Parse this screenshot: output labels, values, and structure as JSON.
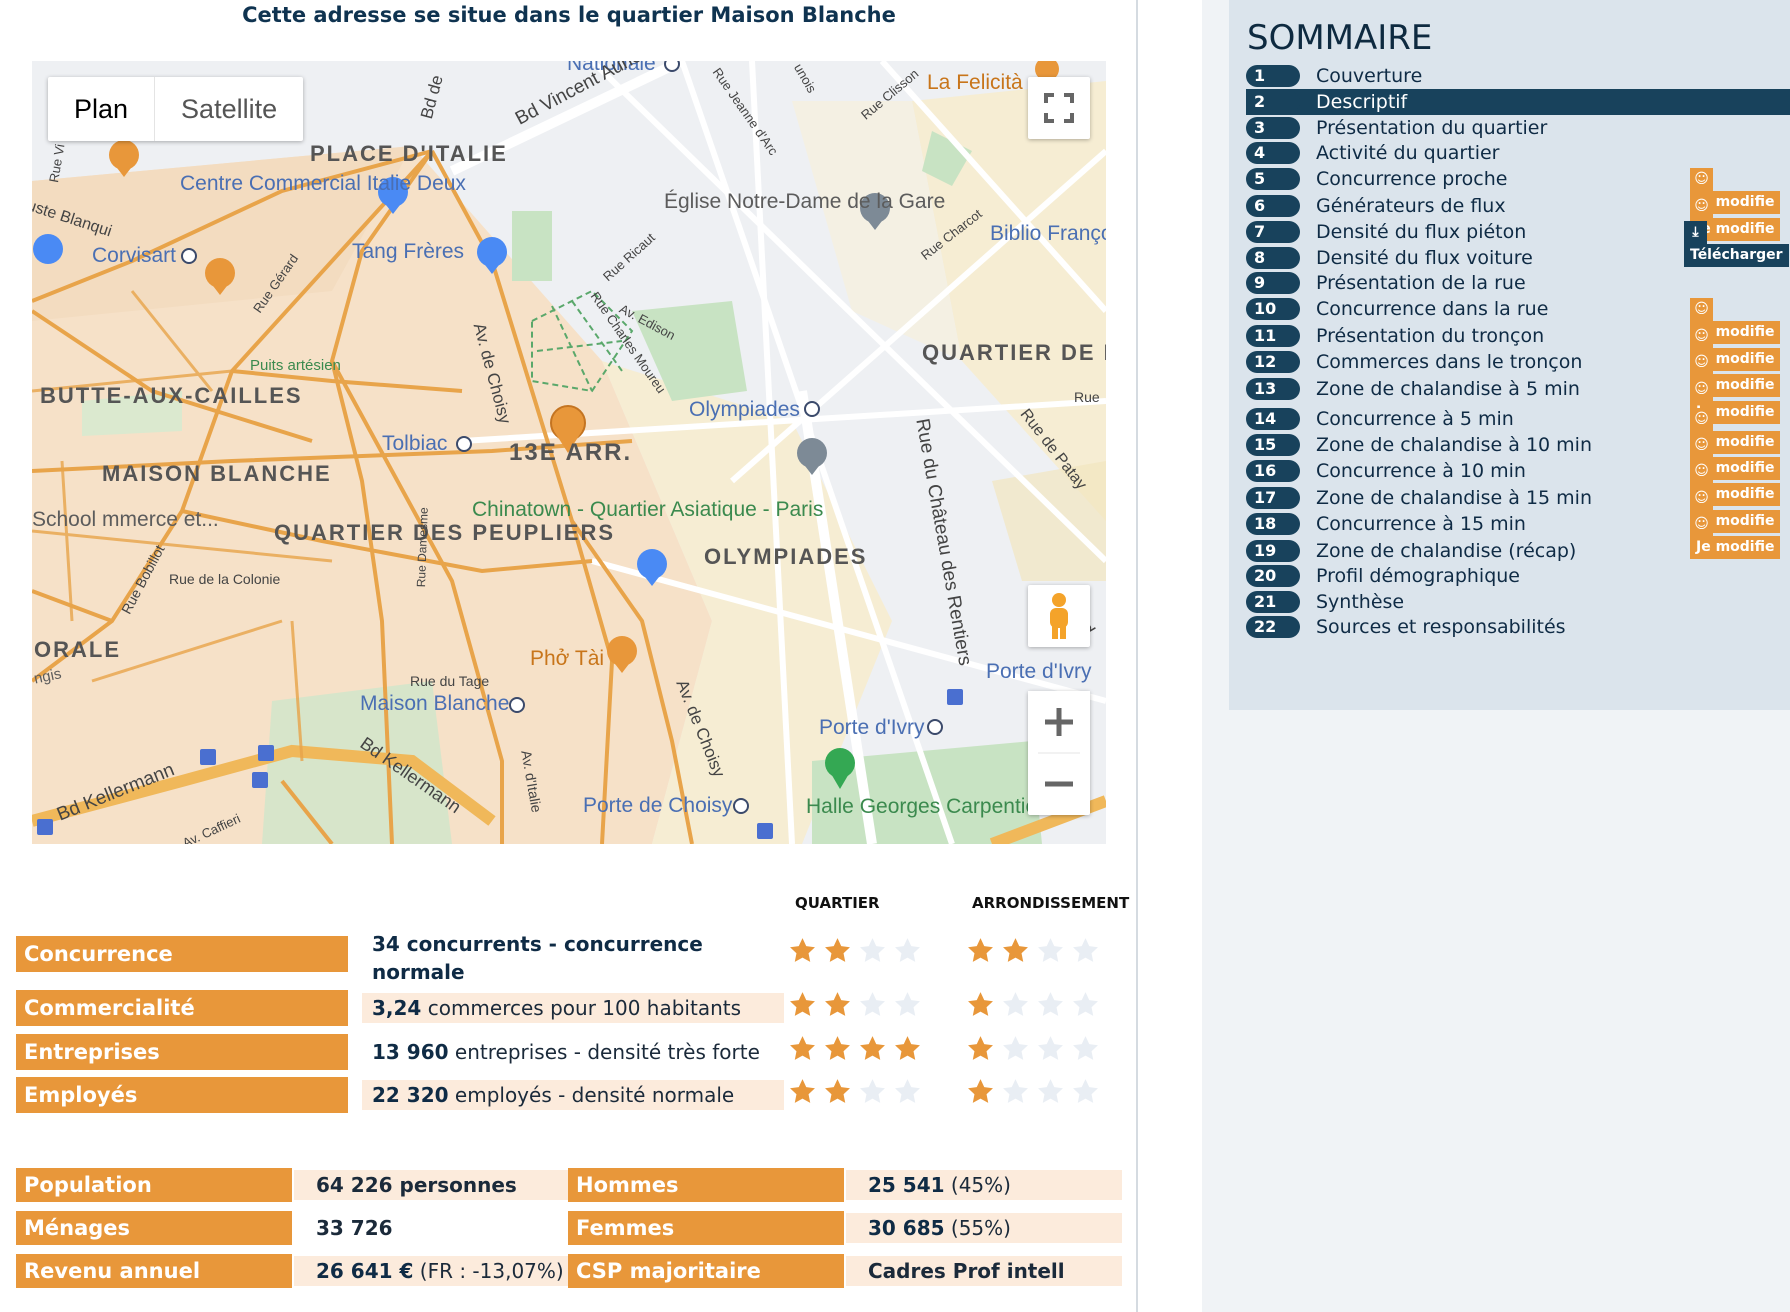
{
  "headline": "Cette adresse se situe dans le quartier Maison Blanche",
  "map": {
    "type_buttons": [
      "Plan",
      "Satellite"
    ],
    "labels": {
      "nationale": "Nationale",
      "la_felicita": "La Felicità",
      "place_italie": "PLACE D'ITALIE",
      "bd_vincent_auriol": "Bd Vincent Auriol",
      "bd_de": "Bd de",
      "centre_commercial": "Centre Commercial Italie Deux",
      "eglise": "Église Notre-Dame de la Gare",
      "corvisart": "Corvisart",
      "tang_freres": "Tang Frères",
      "bibli": "Biblio François Mit",
      "butte_aux_cailles": "BUTTE-AUX-CAILLES",
      "puits_artesien": "Puits artésien",
      "quartier_gare": "QUARTIER DE LA GARE",
      "olympiades_metro": "Olympiades",
      "tolbiac": "Tolbiac",
      "arr": "13E ARR.",
      "maison_blanche": "MAISON BLANCHE",
      "school": "School mmerce et...",
      "quartier_peupliers": "QUARTIER DES PEUPLIERS",
      "chinatown": "Chinatown - Quartier Asiatique - Paris",
      "olympiades": "OLYMPIADES",
      "orale": "ORALE",
      "pho_tai": "Phở Tài",
      "rue_du_tage": "Rue du Tage",
      "maison_blanche_metro": "Maison Blanche",
      "porte_ivry": "Porte d'Ivry",
      "porte_ivry_metro": "Porte d'Ivry",
      "bd_kellermann": "Bd Kellermann",
      "bd_kellermann2": "Bd Kellermann",
      "porte_choisy": "Porte de Choisy",
      "halle": "Halle Georges Carpentier",
      "av_choisy": "Av. de Choisy",
      "av_choisy2": "Av. de Choisy",
      "rue_chateau": "Rue du Château des Rentiers",
      "rue_colonie": "Rue de la Colonie",
      "rue_bobillot": "Rue Bobillot",
      "av_italie": "Av. d'Italie",
      "rue_charcot": "Rue Charcot",
      "av_edison": "Av. Edison",
      "rue_ricaut": "Rue Ricaut",
      "rue_gerard": "Rue Gérard",
      "rue_barrault": "Rue Damesme",
      "av_caffieri": "Av. Caffieri",
      "rue_patay": "Rue de Patay",
      "uste_blanqui": "uste Blanqui",
      "rue_charles_moureu": "Rue Charles Moureu",
      "rue_jeanne_arc": "Rue Jeanne d'Arc",
      "rue_clisson": "Rue Clisson",
      "rue_vi": "Rue Vi",
      "nois": "unois",
      "ngis": "ngis",
      "rue_right": "Rue",
      "bd_right": "Bd"
    }
  },
  "indicators": {
    "col_quartier": "QUARTIER",
    "col_arrondissement": "ARRONDISSEMENT",
    "rows": [
      {
        "label": "Concurrence",
        "value_bold": "34 concurrents - concurrence normale",
        "value_rest": "",
        "quartier": 2,
        "arrondissement": 2
      },
      {
        "label": "Commercialité",
        "value_bold": "3,24",
        "value_rest": " commerces pour 100 habitants",
        "quartier": 2,
        "arrondissement": 1
      },
      {
        "label": "Entreprises",
        "value_bold": "13 960",
        "value_rest": " entreprises - densité très forte",
        "quartier": 4,
        "arrondissement": 1
      },
      {
        "label": "Employés",
        "value_bold": "22 320",
        "value_rest": " employés - densité normale",
        "quartier": 2,
        "arrondissement": 1
      }
    ]
  },
  "demographics": {
    "population_label": "Population",
    "population_value": "64 226 personnes",
    "menages_label": "Ménages",
    "menages_value": "33 726",
    "revenu_label": "Revenu annuel",
    "revenu_value_bold": "26 641 €",
    "revenu_value_rest": " (FR : -13,07%)",
    "hommes_label": "Hommes",
    "hommes_value_bold": "25 541",
    "hommes_value_rest": " (45%)",
    "femmes_label": "Femmes",
    "femmes_value_bold": "30 685",
    "femmes_value_rest": " (55%)",
    "csp_label": "CSP majoritaire",
    "csp_value": "Cadres Prof intell"
  },
  "sommaire": {
    "title": "SOMMAIRE",
    "items": [
      {
        "num": "1",
        "label": "Couverture"
      },
      {
        "num": "2",
        "label": "Descriptif"
      },
      {
        "num": "3",
        "label": "Présentation du quartier"
      },
      {
        "num": "4",
        "label": "Activité du quartier"
      },
      {
        "num": "5",
        "label": "Concurrence proche",
        "button": "Je modifie"
      },
      {
        "num": "6",
        "label": "Générateurs de flux",
        "button": "Je modifie"
      },
      {
        "num": "7",
        "label": "Densité du flux piéton",
        "button": "Télécharger"
      },
      {
        "num": "8",
        "label": "Densité du flux voiture"
      },
      {
        "num": "9",
        "label": "Présentation de la rue"
      },
      {
        "num": "10",
        "label": "Concurrence dans la rue",
        "button": "Je modifie"
      },
      {
        "num": "11",
        "label": "Présentation du tronçon",
        "button": "Je modifie"
      },
      {
        "num": "12",
        "label": "Commerces dans le tronçon",
        "button": "Je modifie"
      },
      {
        "num": "13",
        "label": "Zone de chalandise à 5 min",
        "button": "Je modifie"
      },
      {
        "num": "14",
        "label": "Concurrence à 5 min",
        "button": "Je modifie"
      },
      {
        "num": "15",
        "label": "Zone de chalandise à 10 min",
        "button": "Je modifie"
      },
      {
        "num": "16",
        "label": "Concurrence à 10 min",
        "button": "Je modifie"
      },
      {
        "num": "17",
        "label": "Zone de chalandise à 15 min",
        "button": "Je modifie"
      },
      {
        "num": "18",
        "label": "Concurrence à 15 min",
        "button": "Je modifie"
      },
      {
        "num": "19",
        "label": "Zone de chalandise (récap)"
      },
      {
        "num": "20",
        "label": "Profil démographique"
      },
      {
        "num": "21",
        "label": "Synthèse"
      },
      {
        "num": "22",
        "label": "Sources et responsabilités"
      }
    ]
  },
  "colors": {
    "accent_orange": "#e8973a",
    "navy": "#18425c",
    "light_orange": "#fcebdc",
    "sommaire_bg": "#dbe4ec"
  }
}
